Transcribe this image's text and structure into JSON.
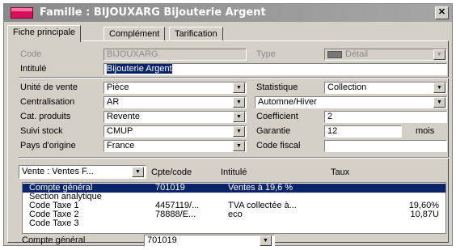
{
  "window": {
    "title": "Famille : BIJOUXARG Bijouterie Argent",
    "close_glyph": "✕",
    "accent_color": "#d60f5a"
  },
  "tabs": [
    {
      "label": "Fiche principale",
      "active": true
    },
    {
      "label": "Complément",
      "active": false
    },
    {
      "label": "Tarification",
      "active": false
    }
  ],
  "form": {
    "code_label": "Code",
    "code_value": "BIJOUXARG",
    "type_label": "Type",
    "type_value": "Détail",
    "intitule_label": "Intitulé",
    "intitule_value": "Bijouterie Argent",
    "unite_label": "Unité de vente",
    "unite_value": "Pièce",
    "statistique_label": "Statistique",
    "statistique_value": "Collection",
    "centralisation_label": "Centralisation",
    "centralisation_value": "AR",
    "saison_value": "Automne/Hiver",
    "cat_label": "Cat. produits",
    "cat_value": "Revente",
    "coefficient_label": "Coefficient",
    "coefficient_value": "2",
    "suivi_label": "Suivi stock",
    "suivi_value": "CMUP",
    "garantie_label": "Garantie",
    "garantie_value": "12",
    "garantie_unit": "mois",
    "pays_label": "Pays d'origine",
    "pays_value": "France",
    "code_fiscal_label": "Code fiscal",
    "code_fiscal_value": ""
  },
  "accounts": {
    "selector_value": "Vente : Ventes F...",
    "headers": [
      "Cpte/code",
      "Intitulé",
      "Taux"
    ],
    "rows": [
      {
        "name": "Compte général",
        "code": "701019",
        "intitule": "Ventes à 19,6 %",
        "taux": "",
        "selected": true
      },
      {
        "name": "Section analytique",
        "code": "",
        "intitule": "",
        "taux": "",
        "selected": false
      },
      {
        "name": "Code Taxe 1",
        "code": "4457119/...",
        "intitule": "TVA collectée à...",
        "taux": "19,60%",
        "selected": false
      },
      {
        "name": "Code Taxe 2",
        "code": "78888/E...",
        "intitule": "eco",
        "taux": "10,87U",
        "selected": false
      },
      {
        "name": "Code Taxe 3",
        "code": "",
        "intitule": "",
        "taux": "",
        "selected": false
      }
    ],
    "footer_label": "Compte général",
    "footer_value": "701019"
  }
}
